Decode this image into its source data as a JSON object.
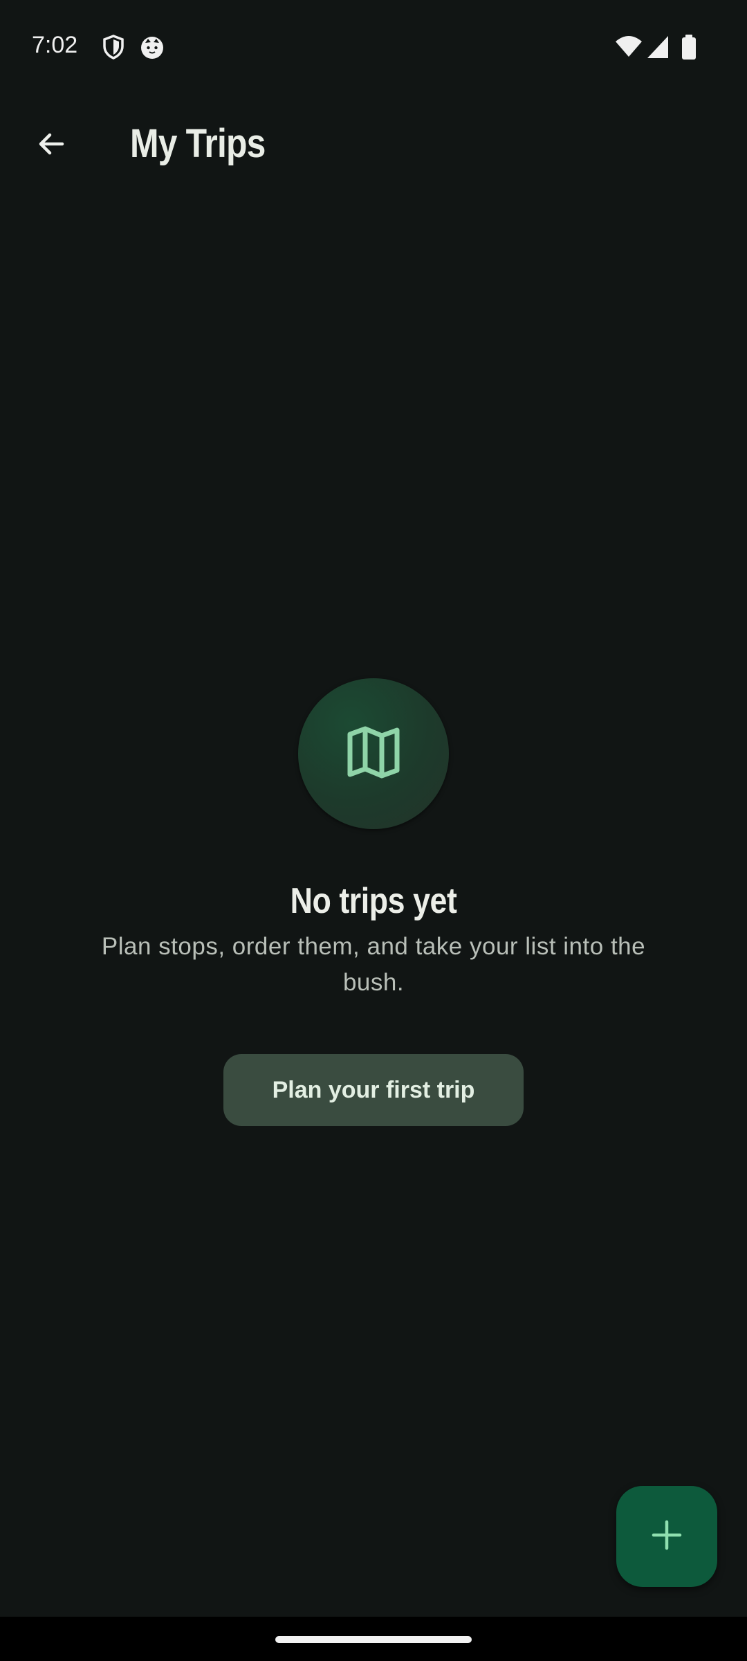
{
  "status_bar": {
    "time": "7:02",
    "left_icons": [
      "shield-icon",
      "cat-face-icon"
    ],
    "right_icons": [
      "wifi-icon",
      "cellular-signal-icon",
      "battery-icon"
    ]
  },
  "app_bar": {
    "back_icon": "arrow-back-icon",
    "title": "My Trips"
  },
  "empty_state": {
    "icon": "map-icon",
    "title": "No trips yet",
    "subtitle": "Plan stops, order them, and take your list into the bush.",
    "button_label": "Plan your first trip"
  },
  "fab": {
    "icon": "plus-icon"
  },
  "colors": {
    "background": "#111514",
    "accent": "#0d5a3c",
    "icon_green": "#8fd4a8",
    "button_bg": "#3a4c40"
  }
}
